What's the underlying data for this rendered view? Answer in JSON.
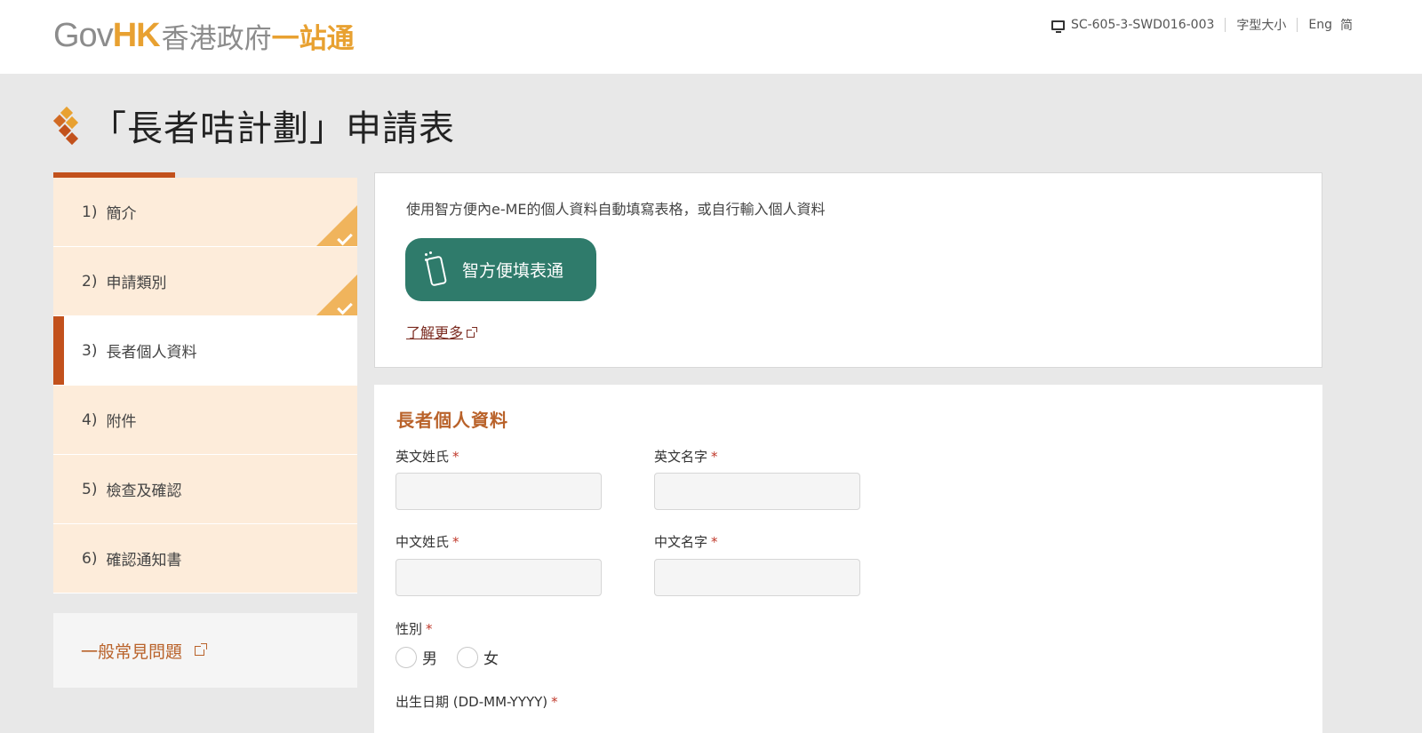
{
  "header": {
    "logo_gov": "Gov",
    "logo_hk": "HK",
    "logo_zh": "香港政府",
    "logo_one": "一站通",
    "form_code": "SC-605-3-SWD016-003",
    "font_size_label": "字型大小",
    "lang_en": "Eng",
    "lang_sc": "简"
  },
  "page": {
    "title": "「長者咭計劃」申請表"
  },
  "sidebar": {
    "steps": [
      {
        "num": "1)",
        "label": "簡介",
        "done": true
      },
      {
        "num": "2)",
        "label": "申請類別",
        "done": true
      },
      {
        "num": "3)",
        "label": "長者個人資料",
        "active": true
      },
      {
        "num": "4)",
        "label": "附件"
      },
      {
        "num": "5)",
        "label": "檢查及確認"
      },
      {
        "num": "6)",
        "label": "確認通知書"
      }
    ],
    "faq_label": "一般常見問題"
  },
  "eme": {
    "description": "使用智方便內e-ME的個人資料自動填寫表格，或自行輸入個人資料",
    "button_label": "智方便填表通",
    "learn_more": "了解更多"
  },
  "form": {
    "section_title": "長者個人資料",
    "required_mark": "*",
    "fields": {
      "en_surname": "英文姓氏",
      "en_given_name": "英文名字",
      "zh_surname": "中文姓氏",
      "zh_given_name": "中文名字",
      "gender": "性別",
      "dob": "出生日期 (DD-MM-YYYY)"
    },
    "gender_options": {
      "male": "男",
      "female": "女"
    }
  },
  "colors": {
    "accent": "#c2511c",
    "brand_orange": "#e8a131",
    "step_bg": "#fdecda",
    "done_tri": "#f0b45c",
    "eme_green": "#2f7b6b",
    "link_red": "#7a2a1f",
    "section_orange": "#b9622a"
  }
}
